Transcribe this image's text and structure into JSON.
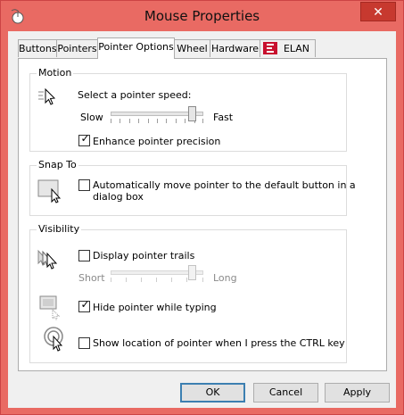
{
  "window": {
    "title": "Mouse Properties",
    "close_glyph": "✕"
  },
  "tabs": [
    {
      "label": "Buttons"
    },
    {
      "label": "Pointers"
    },
    {
      "label": "Pointer Options"
    },
    {
      "label": "Wheel"
    },
    {
      "label": "Hardware"
    },
    {
      "label": "ELAN"
    }
  ],
  "motion": {
    "title": "Motion",
    "speed_label": "Select a pointer speed:",
    "slow_label": "Slow",
    "fast_label": "Fast",
    "speed_level": 0.9,
    "enhance_label": "Enhance pointer precision",
    "enhance_checked": true
  },
  "snap_to": {
    "title": "Snap To",
    "auto_move_label_line1": "Automatically move pointer to the default button in a",
    "auto_move_label_line2": "dialog box",
    "auto_move_checked": false
  },
  "visibility": {
    "title": "Visibility",
    "trails_label": "Display pointer trails",
    "trails_checked": false,
    "short_label": "Short",
    "long_label": "Long",
    "trail_level": 0.9,
    "hide_label": "Hide pointer while typing",
    "hide_checked": true,
    "ctrl_label": "Show location of pointer when I press the CTRL key",
    "ctrl_checked": false
  },
  "buttons": {
    "ok": "OK",
    "cancel": "Cancel",
    "apply": "Apply"
  },
  "colors": {
    "accent": "#e96a63",
    "default_button_border": "#3c7fb1"
  }
}
